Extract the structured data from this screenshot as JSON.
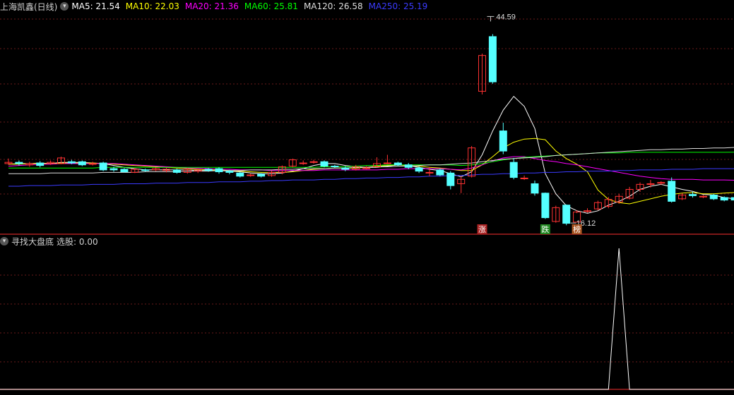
{
  "main_panel": {
    "title": "上海凯鑫(日线)",
    "ma_labels": [
      {
        "text": "MA5: 21.54",
        "color": "#ffffff"
      },
      {
        "text": "MA10: 22.03",
        "color": "#ffff00"
      },
      {
        "text": "MA20: 21.36",
        "color": "#ff00ff"
      },
      {
        "text": "MA60: 25.81",
        "color": "#00ff00"
      },
      {
        "text": "MA120: 26.58",
        "color": "#dddddd"
      },
      {
        "text": "MA250: 25.19",
        "color": "#3b3bff"
      }
    ],
    "high_label": "44.59",
    "low_label": "16.12",
    "markers": [
      {
        "text": "涨",
        "bg": "#aa2222",
        "candle": 45
      },
      {
        "text": "跌",
        "bg": "#228822",
        "candle": 51
      },
      {
        "text": "榜",
        "bg": "#aa5522",
        "candle": 54
      }
    ]
  },
  "sub_panel": {
    "title": "寻找大盘底",
    "value_label": "选股: 0.00"
  },
  "colors": {
    "up": "#ff3232",
    "down": "#54ffff",
    "grid": "#6a1a1a",
    "border": "#a82020"
  },
  "chart_data": {
    "type": "candlestick",
    "price_range": [
      13,
      48
    ],
    "candles": [
      [
        24.0,
        24.2,
        24.8,
        23.8
      ],
      [
        24.2,
        24.0,
        24.5,
        23.7
      ],
      [
        23.8,
        24.0,
        24.3,
        23.5
      ],
      [
        24.1,
        23.7,
        24.4,
        23.4
      ],
      [
        24.0,
        24.2,
        24.5,
        23.8
      ],
      [
        24.0,
        24.9,
        25.1,
        23.9
      ],
      [
        24.3,
        24.1,
        24.6,
        23.9
      ],
      [
        24.3,
        23.8,
        24.5,
        23.6
      ],
      [
        24.0,
        24.0,
        24.3,
        23.7
      ],
      [
        24.1,
        23.0,
        24.3,
        22.8
      ],
      [
        23.2,
        23.0,
        23.5,
        22.7
      ],
      [
        23.1,
        22.7,
        23.3,
        22.6
      ],
      [
        22.6,
        23.1,
        23.3,
        22.5
      ],
      [
        23.0,
        22.9,
        23.2,
        22.7
      ],
      [
        23.0,
        23.2,
        23.4,
        22.8
      ],
      [
        22.9,
        23.1,
        23.3,
        22.6
      ],
      [
        23.0,
        22.6,
        23.2,
        22.4
      ],
      [
        22.6,
        23.0,
        23.3,
        22.4
      ],
      [
        22.8,
        23.0,
        23.2,
        22.5
      ],
      [
        23.1,
        22.9,
        23.3,
        22.7
      ],
      [
        23.2,
        22.7,
        23.4,
        22.4
      ],
      [
        22.8,
        22.6,
        23.0,
        22.3
      ],
      [
        22.5,
        22.0,
        22.7,
        21.8
      ],
      [
        22.1,
        22.2,
        22.4,
        21.9
      ],
      [
        22.3,
        22.0,
        22.5,
        21.8
      ],
      [
        22.1,
        22.6,
        22.9,
        21.9
      ],
      [
        22.6,
        23.5,
        23.7,
        22.3
      ],
      [
        23.6,
        24.6,
        24.8,
        23.4
      ],
      [
        24.1,
        24.1,
        24.5,
        23.8
      ],
      [
        24.3,
        24.3,
        24.6,
        24.0
      ],
      [
        24.3,
        23.6,
        24.5,
        23.4
      ],
      [
        23.6,
        23.5,
        23.8,
        23.3
      ],
      [
        23.3,
        23.1,
        23.6,
        22.8
      ],
      [
        23.1,
        23.5,
        23.8,
        22.9
      ],
      [
        23.3,
        23.3,
        23.6,
        23.1
      ],
      [
        23.5,
        24.0,
        25.0,
        23.4
      ],
      [
        24.1,
        24.1,
        25.4,
        23.9
      ],
      [
        24.1,
        23.8,
        24.3,
        23.6
      ],
      [
        23.8,
        23.4,
        24.1,
        23.1
      ],
      [
        23.3,
        22.8,
        23.6,
        22.5
      ],
      [
        22.6,
        22.6,
        23.5,
        22.0
      ],
      [
        23.0,
        22.2,
        23.2,
        22.0
      ],
      [
        22.5,
        20.5,
        22.8,
        19.9
      ],
      [
        20.8,
        21.5,
        22.0,
        19.3
      ],
      [
        22.0,
        26.5,
        26.8,
        21.8
      ],
      [
        35.5,
        41.2,
        41.5,
        35.0
      ],
      [
        44.2,
        37.0,
        44.59,
        36.7
      ],
      [
        29.2,
        26.0,
        30.5,
        25.5
      ],
      [
        24.2,
        21.8,
        24.9,
        21.5
      ],
      [
        21.7,
        21.7,
        22.1,
        21.4
      ],
      [
        20.8,
        19.3,
        21.3,
        18.9
      ],
      [
        19.3,
        15.4,
        19.4,
        15.2
      ],
      [
        14.8,
        17.0,
        17.3,
        14.6
      ],
      [
        17.4,
        14.5,
        17.5,
        14.2
      ],
      [
        14.7,
        16.3,
        16.6,
        16.12
      ],
      [
        16.5,
        16.5,
        16.9,
        16.2
      ],
      [
        16.8,
        17.8,
        18.1,
        16.6
      ],
      [
        17.2,
        18.3,
        18.7,
        16.9
      ],
      [
        17.9,
        18.8,
        19.2,
        17.6
      ],
      [
        18.5,
        19.9,
        20.3,
        18.3
      ],
      [
        19.9,
        20.7,
        21.0,
        19.5
      ],
      [
        20.8,
        20.8,
        21.4,
        20.2
      ],
      [
        21.0,
        21.0,
        21.2,
        20.6
      ],
      [
        21.2,
        18.0,
        21.8,
        17.8
      ],
      [
        18.4,
        19.0,
        19.3,
        18.2
      ],
      [
        19.1,
        18.9,
        19.5,
        18.6
      ],
      [
        18.8,
        18.8,
        19.0,
        18.5
      ],
      [
        19.0,
        18.4,
        19.2,
        18.2
      ],
      [
        18.6,
        18.2,
        18.8,
        18.0
      ],
      [
        18.6,
        18.2,
        18.9,
        17.9
      ]
    ],
    "ma_series": [
      {
        "name": "MA5",
        "color": "#ffffff",
        "values": [
          23.9,
          24.0,
          24.0,
          24.1,
          24.0,
          24.2,
          24.2,
          24.2,
          24.1,
          24.0,
          23.7,
          23.4,
          23.2,
          23.0,
          23.0,
          23.0,
          23.0,
          23.0,
          22.9,
          22.9,
          22.9,
          22.8,
          22.7,
          22.5,
          22.4,
          22.4,
          22.5,
          22.8,
          23.2,
          23.7,
          24.0,
          24.0,
          23.7,
          23.5,
          23.4,
          23.4,
          23.6,
          23.8,
          23.7,
          23.4,
          23.1,
          22.9,
          22.4,
          21.9,
          22.7,
          25.4,
          29.2,
          32.5,
          34.7,
          33.1,
          29.6,
          22.4,
          19.2,
          17.3,
          16.5,
          16.1,
          16.5,
          17.4,
          18.0,
          18.8,
          19.9,
          20.4,
          20.7,
          20.3,
          19.9,
          19.6,
          19.1,
          19.0,
          18.6,
          18.4
        ]
      },
      {
        "name": "MA10",
        "color": "#ffff00",
        "values": [
          23.9,
          23.9,
          24.0,
          24.0,
          24.0,
          24.1,
          24.1,
          24.1,
          24.1,
          24.0,
          23.9,
          23.8,
          23.7,
          23.6,
          23.5,
          23.4,
          23.3,
          23.2,
          23.1,
          23.0,
          23.0,
          22.9,
          22.8,
          22.7,
          22.6,
          22.6,
          22.6,
          22.7,
          22.9,
          23.1,
          23.2,
          23.3,
          23.3,
          23.3,
          23.4,
          23.6,
          23.7,
          23.8,
          23.7,
          23.6,
          23.4,
          23.3,
          23.1,
          22.9,
          22.9,
          23.8,
          25.1,
          26.5,
          27.4,
          27.9,
          28.0,
          27.8,
          26.0,
          24.8,
          23.9,
          22.7,
          19.8,
          18.3,
          17.8,
          17.6,
          18.0,
          18.4,
          18.8,
          19.1,
          19.3,
          19.4,
          19.2,
          19.2,
          19.3,
          19.4
        ]
      },
      {
        "name": "MA20",
        "color": "#ff00ff",
        "values": [
          23.6,
          23.7,
          23.8,
          23.9,
          23.9,
          24.0,
          24.0,
          24.0,
          24.0,
          24.0,
          24.0,
          23.9,
          23.8,
          23.7,
          23.6,
          23.5,
          23.4,
          23.3,
          23.3,
          23.2,
          23.1,
          23.1,
          23.0,
          23.0,
          23.0,
          22.9,
          22.9,
          22.9,
          22.9,
          22.9,
          23.0,
          23.0,
          23.0,
          23.0,
          23.0,
          23.0,
          23.1,
          23.1,
          23.2,
          23.2,
          23.2,
          23.2,
          23.1,
          23.0,
          23.3,
          23.8,
          24.4,
          24.9,
          25.1,
          25.1,
          24.8,
          24.5,
          24.3,
          24.0,
          23.8,
          23.5,
          23.2,
          22.9,
          22.6,
          22.3,
          22.0,
          21.8,
          21.6,
          21.5,
          21.5,
          21.5,
          21.4,
          21.4,
          21.4,
          21.36
        ]
      },
      {
        "name": "MA60",
        "color": "#00ff00",
        "values": [
          23.3,
          23.3,
          23.3,
          23.3,
          23.3,
          23.3,
          23.3,
          23.3,
          23.3,
          23.4,
          23.4,
          23.4,
          23.4,
          23.4,
          23.4,
          23.4,
          23.4,
          23.4,
          23.4,
          23.4,
          23.4,
          23.4,
          23.4,
          23.4,
          23.4,
          23.4,
          23.4,
          23.4,
          23.4,
          23.4,
          23.5,
          23.5,
          23.5,
          23.6,
          23.7,
          23.7,
          23.8,
          23.8,
          23.8,
          23.8,
          23.8,
          23.8,
          23.8,
          23.7,
          23.8,
          24.0,
          24.3,
          24.6,
          24.8,
          25.0,
          25.1,
          25.2,
          25.3,
          25.4,
          25.5,
          25.6,
          25.7,
          25.7,
          25.7,
          25.8,
          25.8,
          25.8,
          25.8,
          25.8,
          25.8,
          25.8,
          25.8,
          25.8,
          25.8,
          25.81
        ]
      },
      {
        "name": "MA120",
        "color": "#dddddd",
        "values": [
          22.4,
          22.4,
          22.4,
          22.4,
          22.5,
          22.5,
          22.5,
          22.5,
          22.5,
          22.6,
          22.6,
          22.6,
          22.6,
          22.7,
          22.7,
          22.7,
          22.7,
          22.8,
          22.8,
          22.8,
          22.9,
          22.9,
          22.9,
          23.0,
          23.0,
          23.0,
          23.1,
          23.1,
          23.2,
          23.2,
          23.2,
          23.3,
          23.3,
          23.4,
          23.4,
          23.5,
          23.5,
          23.6,
          23.6,
          23.7,
          23.8,
          23.8,
          23.9,
          24.0,
          24.1,
          24.3,
          24.5,
          24.7,
          24.8,
          24.9,
          25.0,
          25.1,
          25.3,
          25.4,
          25.5,
          25.6,
          25.7,
          25.8,
          25.9,
          26.0,
          26.1,
          26.2,
          26.2,
          26.3,
          26.3,
          26.4,
          26.4,
          26.5,
          26.5,
          26.58
        ]
      },
      {
        "name": "MA250",
        "color": "#3b3bff",
        "values": [
          20.4,
          20.4,
          20.5,
          20.5,
          20.5,
          20.6,
          20.6,
          20.6,
          20.7,
          20.7,
          20.7,
          20.8,
          20.8,
          20.8,
          20.9,
          20.9,
          20.9,
          21.0,
          21.0,
          21.0,
          21.1,
          21.1,
          21.1,
          21.2,
          21.2,
          21.3,
          21.3,
          21.4,
          21.4,
          21.4,
          21.5,
          21.5,
          21.6,
          21.6,
          21.7,
          21.7,
          21.8,
          21.8,
          21.9,
          21.9,
          22.0,
          22.0,
          22.1,
          22.1,
          22.2,
          22.3,
          22.3,
          22.4,
          22.4,
          22.5,
          22.5,
          22.6,
          22.6,
          22.7,
          22.7,
          22.8,
          22.8,
          22.8,
          22.9,
          22.9,
          23.0,
          23.0,
          23.0,
          23.1,
          23.1,
          23.1,
          23.2,
          23.2,
          23.2,
          23.2
        ]
      }
    ],
    "signal": {
      "name": "选股",
      "color": "#ffffff",
      "index": 58,
      "peak": 1
    }
  }
}
